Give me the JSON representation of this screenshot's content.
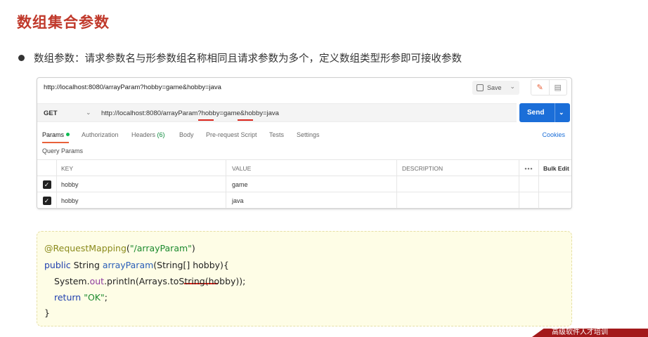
{
  "slide": {
    "title": "数组集合参数",
    "bullet": "数组参数：请求参数名与形参数组名称相同且请求参数为多个，定义数组类型形参即可接收参数",
    "brand_text": "高级软件人才培训"
  },
  "postman": {
    "tab_title_url": "http://localhost:8080/arrayParam?hobby=game&hobby=java",
    "save_label": "Save",
    "method": "GET",
    "request_url": "http://localhost:8080/arrayParam?hobby=game&hobby=java",
    "send_label": "Send",
    "tabs": [
      {
        "label": "Params"
      },
      {
        "label": "Authorization"
      },
      {
        "label": "Headers",
        "count": "(6)"
      },
      {
        "label": "Body"
      },
      {
        "label": "Pre-request Script"
      },
      {
        "label": "Tests"
      },
      {
        "label": "Settings"
      }
    ],
    "cookies_label": "Cookies",
    "query_params_label": "Query Params",
    "columns": {
      "key": "KEY",
      "value": "VALUE",
      "description": "DESCRIPTION",
      "more": "•••",
      "bulk_edit": "Bulk Edit"
    },
    "rows": [
      {
        "key": "hobby",
        "value": "game",
        "description": "",
        "checked": true
      },
      {
        "key": "hobby",
        "value": "java",
        "description": "",
        "checked": true
      }
    ]
  },
  "code": {
    "l1_annotation": "@RequestMapping",
    "l1_open": "(",
    "l1_string": "\"/arrayParam\"",
    "l1_close": ")",
    "l2_public": "public",
    "l2_type": " String ",
    "l2_method": "arrayParam",
    "l2_params": "(String[] hobby){",
    "l3_system": "System.",
    "l3_out": "out",
    "l3_rest": ".println(Arrays.toString(hobby));",
    "l4_return": "return",
    "l4_string": "\"OK\"",
    "l4_end": ";",
    "l5": "}"
  },
  "colors": {
    "title": "#c0392b",
    "send": "#1b6ed8",
    "accent": "#e8613a",
    "underline": "#d9241b",
    "code_bg": "#fefde6"
  }
}
